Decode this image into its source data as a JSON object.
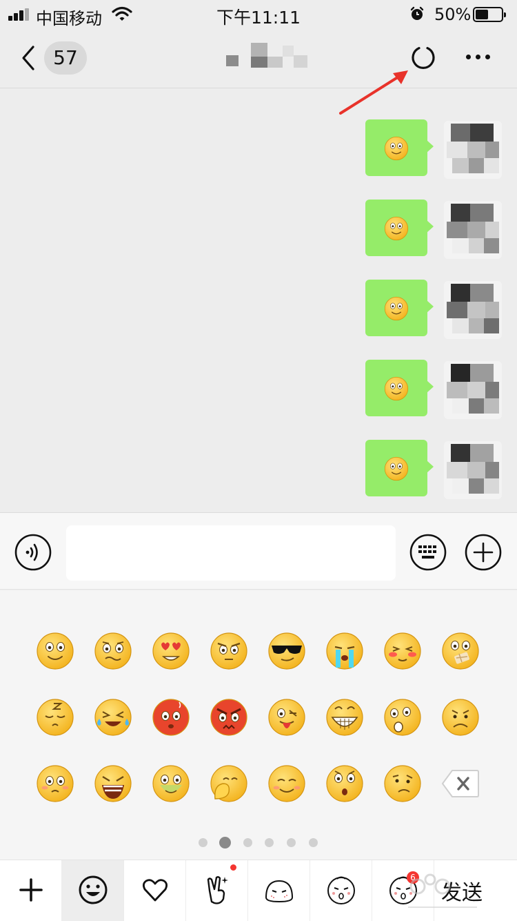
{
  "status_bar": {
    "carrier": "中国移动",
    "time": "下午11:11",
    "battery_percent": "50%",
    "battery_level": 0.5
  },
  "nav": {
    "unread_count": "57",
    "back_icon": "chevron-left-icon",
    "refresh_icon": "refresh-icon",
    "more_icon": "more-dots-icon"
  },
  "messages": [
    {
      "type": "emoji",
      "emoji": "smile",
      "side": "right"
    },
    {
      "type": "emoji",
      "emoji": "smile",
      "side": "right"
    },
    {
      "type": "emoji",
      "emoji": "smile",
      "side": "right"
    },
    {
      "type": "emoji",
      "emoji": "smile",
      "side": "right"
    },
    {
      "type": "emoji",
      "emoji": "smile",
      "side": "right"
    }
  ],
  "input": {
    "value": "",
    "placeholder": "",
    "voice_icon": "voice-icon",
    "keyboard_icon": "keyboard-icon",
    "plus_icon": "plus-circle-icon"
  },
  "emoji_grid": [
    [
      "smile",
      "awkward",
      "heart-eyes",
      "angry-stare",
      "cool",
      "cry",
      "shy",
      "shut-mouth"
    ],
    [
      "sleepy",
      "laugh-cry",
      "hot-red",
      "furious",
      "tongue-wink",
      "grin",
      "surprised",
      "sad"
    ],
    [
      "teary",
      "scream",
      "sick",
      "facepalm",
      "blush",
      "shocked",
      "confused"
    ]
  ],
  "pager": {
    "count": 5,
    "active": 0,
    "recent_icon": "clock-icon"
  },
  "tabs": [
    {
      "name": "add",
      "icon": "plus-icon"
    },
    {
      "name": "emoji",
      "icon": "smiley-icon",
      "selected": true
    },
    {
      "name": "favorites",
      "icon": "heart-icon"
    },
    {
      "name": "custom",
      "icon": "peace-hand-icon",
      "badge": "dot"
    },
    {
      "name": "sticker1",
      "icon": "blob-sticker-icon"
    },
    {
      "name": "sticker2",
      "icon": "face-sticker-icon"
    },
    {
      "name": "sticker3",
      "icon": "face-sticker-icon",
      "badge_text": "6"
    }
  ],
  "send_label": "发送",
  "colors": {
    "bubble": "#95ec69",
    "background": "#ededed",
    "badge": "#f43530",
    "arrow": "#e8322a"
  }
}
